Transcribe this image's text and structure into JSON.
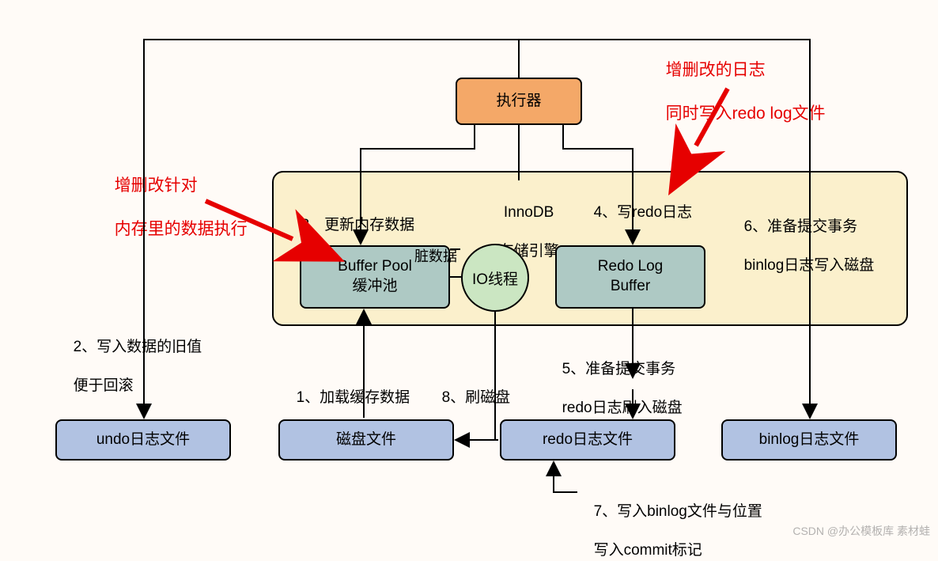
{
  "title_red1_line1": "增删改针对",
  "title_red1_line2": "内存里的数据执行",
  "title_red2_line1": "增删改的日志",
  "title_red2_line2": "同时写入redo log文件",
  "nodes": {
    "executor": "执行器",
    "engine_label_line1": "InnoDB",
    "engine_label_line2": "存储引擎",
    "buffer_pool_line1": "Buffer Pool",
    "buffer_pool_line2": "缓冲池",
    "io_thread": "IO线程",
    "redo_buffer_line1": "Redo Log",
    "redo_buffer_line2": "Buffer",
    "dirty_label": "脏数据",
    "undo_file": "undo日志文件",
    "disk_file": "磁盘文件",
    "redo_file": "redo日志文件",
    "binlog_file": "binlog日志文件"
  },
  "steps": {
    "s1": "1、加载缓存数据",
    "s2_line1": "2、写入数据的旧值",
    "s2_line2": "便于回滚",
    "s3": "3、更新内存数据",
    "s4": "4、写redo日志",
    "s5_line1": "5、准备提交事务",
    "s5_line2": "redo日志刷入磁盘",
    "s6_line1": "6、准备提交事务",
    "s6_line2": "binlog日志写入磁盘",
    "s7_line1": "7、写入binlog文件与位置",
    "s7_line2": "写入commit标记",
    "s8": "8、刷磁盘"
  },
  "watermark": "CSDN @办公模板库 素材蛙"
}
